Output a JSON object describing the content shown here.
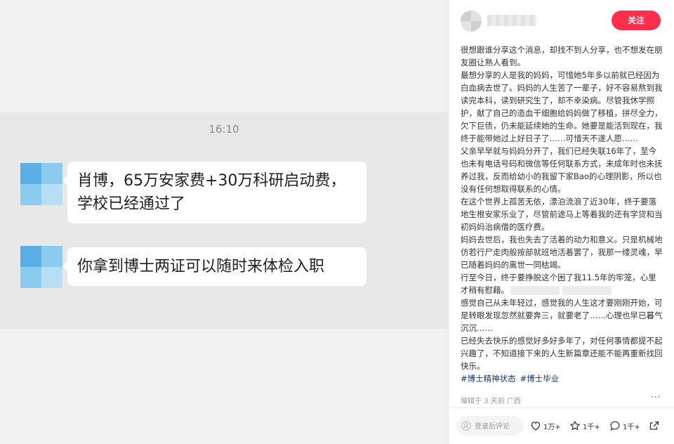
{
  "chat": {
    "time": "16:10",
    "messages": [
      {
        "text": "肖博，65万安家费+30万科研启动费，学校已经通过了"
      },
      {
        "text": "你拿到博士两证可以随时来体检入职"
      }
    ]
  },
  "post": {
    "follow_label": "关注",
    "paragraphs": [
      "很想跟谁分享这个消息，却找不到人分享，也不想发在朋友圈让熟人看到。",
      "最想分享的人是我的妈妈，可惜她5年多以前就已经因为白血病去世了。妈妈的人生苦了一辈子，好不容易熬到我读完本科，读到研究生了，却不幸染病。尽管我休学照护，献了自己的造血干细胞给妈妈做了移植，拼尽全力，欠下巨债，仍未能延续她的生命。她要是能活到现在，我终于能带她过上好日子了……可惜天不遂人愿……",
      "父亲早早就与妈妈分开了，我们已经失联16年了，至今也未有电话号码和微信等任何联系方式，未成年时也未抚养过我，反而给幼小的我留下家Bao的心理阴影，所以也没有任何想取得联系的心情。",
      "在这个世界上孤苦无依，漂泊流浪了近30年，终于要落地生根安家乐业了，尽管前途马上等着我的还有学贷和当初妈妈治病借的医疗费。",
      "妈妈去世后，我也失去了活着的动力和意义。只是机械地仿若行尸走肉般按部就班地活着罢了，我那一缕灵魂，早已随着妈妈的离世一同枯竭。"
    ],
    "para6_before": "行至今日，终于要挣脱这个困了我11.5年的牢笼，心里才稍有慰藉。",
    "paragraphs_after": [
      "感觉自己从未年轻过，感觉我的人生这才要刚刚开始，可是转眼发现忽然就要奔三，就要老了……心理也早已暮气沉沉……",
      "已经失去快乐的感觉好多好多年了，对任何事情都提不起兴趣了，不知道接下来的人生新篇章还能不能再重新找回快乐。"
    ],
    "tags": [
      "#博士精神状态",
      "#博士毕业"
    ],
    "meta": "编辑于 3 天前 广西",
    "more": "···",
    "comment_placeholder": "登录后评论",
    "likes": "1万+",
    "collects": "1千+",
    "comments": "1千+"
  },
  "colors": {
    "accent": "#ff2e4d",
    "tag": "#13386c",
    "chat_bg": "#e8e8e8"
  }
}
